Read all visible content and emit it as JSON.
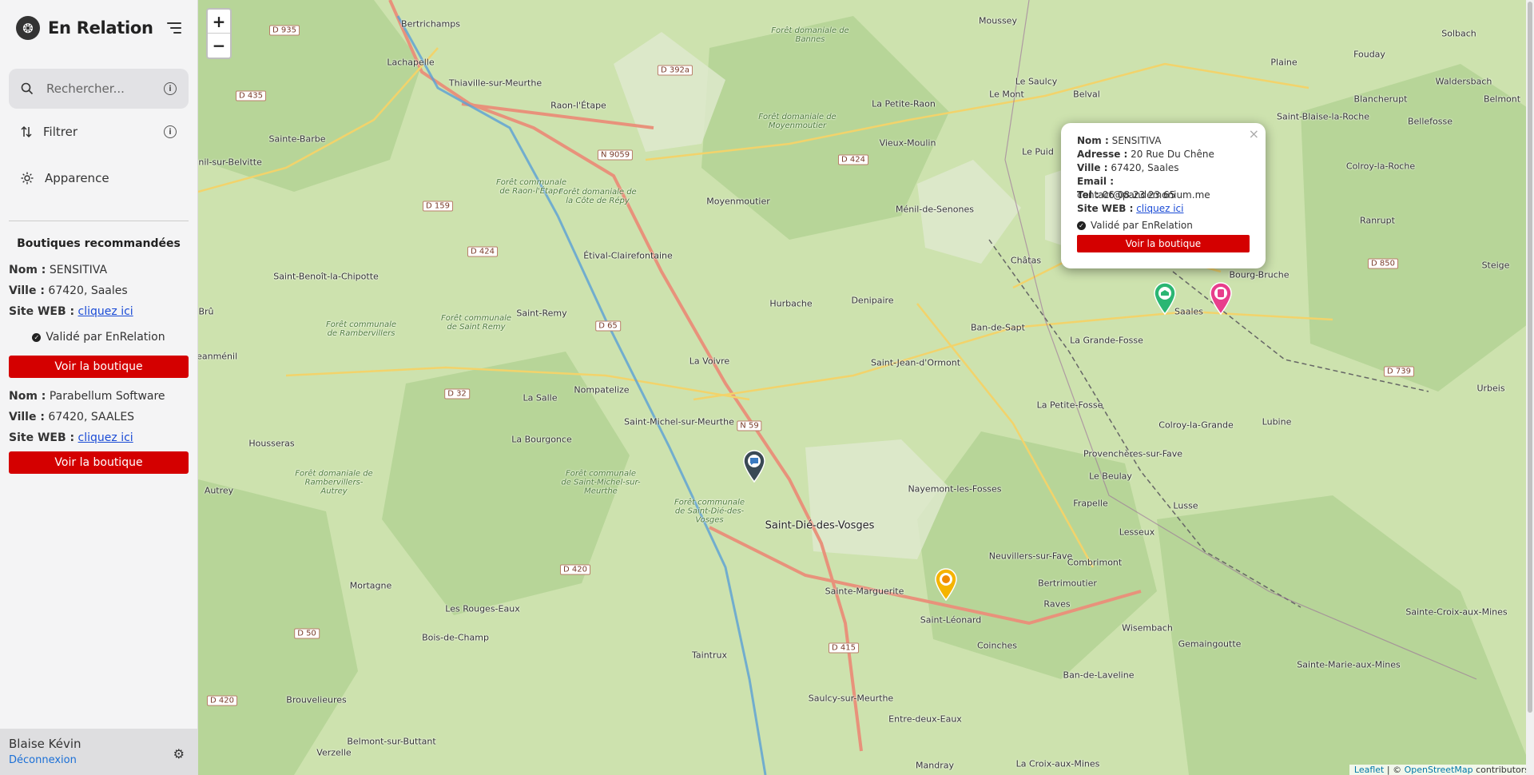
{
  "app": {
    "title": "En Relation"
  },
  "search": {
    "placeholder": "Rechercher..."
  },
  "nav": {
    "filter_label": "Filtrer",
    "appearance_label": "Apparence"
  },
  "recommended": {
    "title": "Boutiques recommandées",
    "name_label": "Nom :",
    "city_label": "Ville :",
    "web_label": "Site WEB :",
    "shops": [
      {
        "name": "SENSITIVA",
        "city": "67420, Saales",
        "web_link": "cliquez ici",
        "validated": "Validé par EnRelation",
        "button": "Voir la boutique"
      },
      {
        "name": "Parabellum Software",
        "city": "67420, SAALES",
        "web_link": "cliquez ici",
        "button": "Voir la boutique"
      }
    ]
  },
  "user": {
    "name": "Blaise Kévin",
    "logout": "Déconnexion"
  },
  "map": {
    "zoom_in": "+",
    "zoom_out": "−",
    "places": [
      "Bertrichamps",
      "Lachapelle",
      "Thiaville-sur-Meurthe",
      "Raon-l'Étape",
      "Moussey",
      "Le Saulcy",
      "Belval",
      "Le Mont",
      "La Petite-Raon",
      "Vieux-Moulin",
      "Le Puid",
      "Sainte-Barbe",
      "Moyenmoutier",
      "Ménil-de-Senones",
      "Saint-Benoît-la-Chipotte",
      "Étival-Clairefontaine",
      "Hurbache",
      "Denipaire",
      "Saint-Remy",
      "Châtas",
      "Bourg-Bruche",
      "Saales",
      "Ban-de-Sapt",
      "La Grande-Fosse",
      "Saint-Jean-d'Ormont",
      "La Voivre",
      "Nompatelize",
      "La Salle",
      "Saint-Michel-sur-Meurthe",
      "La Bourgonce",
      "Housseras",
      "Saint-Dié-des-Vosges",
      "Nayemont-les-Fosses",
      "Provenchères-sur-Fave",
      "La Petite-Fosse",
      "Colroy-la-Grande",
      "Lubine",
      "Le Beulay",
      "Frapelle",
      "Lusse",
      "Lesseux",
      "Neuvillers-sur-Fave",
      "Combrimont",
      "Bertrimoutier",
      "Sainte-Marguerite",
      "Raves",
      "Wisembach",
      "Gemaingoutte",
      "Coinches",
      "Ban-de-Laveline",
      "Saint-Léonard",
      "Taintrux",
      "Bois-de-Champ",
      "Les Rouges-Eaux",
      "Mortagne",
      "Brouvelieures",
      "Belmont-sur-Buttant",
      "Verzelle",
      "Saulcy-sur-Meurthe",
      "Entre-deux-Eaux",
      "Mandray",
      "La Croix-aux-Mines",
      "Sainte-Marie-aux-Mines",
      "Sainte-Croix-aux-Mines",
      "Plaine",
      "Fouday",
      "Solbach",
      "Waldersbach",
      "Blancherupt",
      "Saint-Blaise-la-Roche",
      "Belmont",
      "Bellefosse",
      "Colroy-la-Roche",
      "Ranrupt",
      "Steige",
      "Urbeis",
      "Autrey",
      "Jeanménil",
      "Brû",
      "Ménil-sur-Belvitte"
    ],
    "forests": [
      "Forêt domaniale de Moyenmoutier",
      "Forêt communale de Raon-l'Étape",
      "Forêt domaniale de la Côte de Répy",
      "Forêt domaniale de Rambervillers-Autrey",
      "Forêt communale de Saint-Michel-sur-Meurthe",
      "Forêt communale de Saint-Dié-des-Vosges",
      "Forêt communale de Saint Remy",
      "Forêt communale de Rambervillers",
      "Forêt domaniale de Bannes"
    ],
    "roads": [
      "D 935",
      "D 392a",
      "D 435",
      "N 9059",
      "D 424",
      "D 159",
      "D 424",
      "D 65",
      "D 32",
      "N 59",
      "D 420",
      "D 50",
      "D 415",
      "D 420",
      "D 850",
      "D 739"
    ],
    "markers": [
      {
        "name": "SENSITIVA",
        "color": "#2bb673",
        "icon": "store-icon"
      },
      {
        "name": "Parabellum Software",
        "color": "#e83e8c",
        "icon": "device-icon"
      },
      {
        "name": "shop-marker-saint-michel",
        "color": "#3a4a55",
        "icon": "chat-icon"
      },
      {
        "name": "shop-marker-sainte-marguerite",
        "color": "#f5b400",
        "icon": "orange-icon"
      }
    ],
    "popup": {
      "name_label": "Nom :",
      "name": "SENSITIVA",
      "address_label": "Adresse :",
      "address": "20 Rue Du Chêne",
      "city_label": "Ville :",
      "city": "67420, Saales",
      "email_label": "Email :",
      "email": "contact@pandemonium.me",
      "tel_label": "Tel :",
      "tel": "06 08 23 23 65",
      "web_label": "Site WEB :",
      "web_link": "cliquez ici",
      "validated": "Validé par EnRelation",
      "button": "Voir la boutique",
      "close": "×"
    },
    "attribution": {
      "leaflet": "Leaflet",
      "sep": " | © ",
      "osm": "OpenStreetMap",
      "contrib": " contributors"
    }
  }
}
